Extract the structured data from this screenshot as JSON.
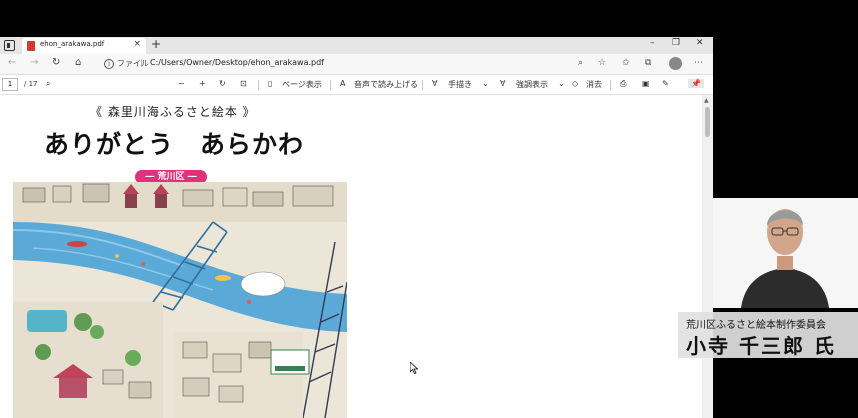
{
  "browser": {
    "tab": {
      "title": "ehon_arakawa.pdf",
      "close": "×"
    },
    "new_tab": "+",
    "window_controls": {
      "minimize": "–",
      "maximize": "❐",
      "close": "✕"
    },
    "address": {
      "scheme_label": "ファイル",
      "path": "C:/Users/Owner/Desktop/ehon_arakawa.pdf"
    }
  },
  "pdf_toolbar": {
    "page_current": "1",
    "page_total": "/ 17",
    "zoom_out": "−",
    "zoom_in": "+",
    "page_view_label": "ページ表示",
    "read_aloud_label": "音声で読み上げる",
    "draw_label": "手描き",
    "highlight_label": "強調表示",
    "erase_label": "消去"
  },
  "document": {
    "subtitle": "《 森里川海ふるさと絵本 》",
    "title": "ありがとう　あらかわ",
    "ward_label": "― 荒川区 ―"
  },
  "presenter": {
    "organization": "荒川区ふるさと絵本制作委員会",
    "name": "小寺 千三郎 氏"
  },
  "colors": {
    "ward_pill": "#e0327a",
    "pdf_icon": "#d23a2f"
  }
}
